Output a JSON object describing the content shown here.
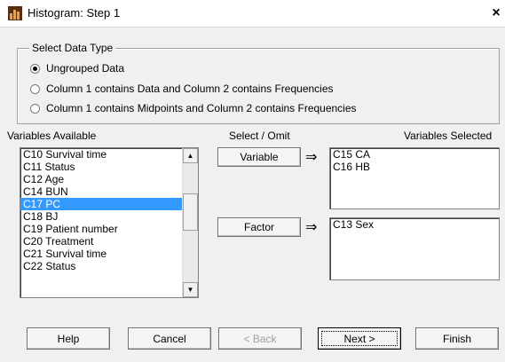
{
  "window": {
    "title": "Histogram: Step 1",
    "close_glyph": "×"
  },
  "data_type": {
    "group_label": "Select Data Type",
    "options": [
      {
        "label": "Ungrouped Data",
        "checked": true
      },
      {
        "label": "Column 1 contains Data and Column 2 contains Frequencies",
        "checked": false
      },
      {
        "label": "Column 1 contains Midpoints and Column 2 contains Frequencies",
        "checked": false
      }
    ]
  },
  "available": {
    "label": "Variables Available",
    "items": [
      "C10 Survival time",
      "C11 Status",
      "C12 Age",
      "C14 BUN",
      "C17 PC",
      "C18 BJ",
      "C19 Patient number",
      "C20 Treatment",
      "C21 Survival time",
      "C22 Status"
    ],
    "selected_index": 4
  },
  "select_omit": {
    "label": "Select / Omit",
    "variable_button": "Variable",
    "factor_button": "Factor",
    "arrow": "⇒"
  },
  "selected": {
    "label": "Variables Selected",
    "variables": [
      "C15 CA",
      "C16 HB"
    ],
    "factors": [
      "C13 Sex"
    ]
  },
  "buttons": {
    "help": "Help",
    "cancel": "Cancel",
    "back": "< Back",
    "next": "Next >",
    "finish": "Finish"
  },
  "icons": {
    "scroll_up": "▲",
    "scroll_down": "▼",
    "app": "histogram-app-icon"
  }
}
